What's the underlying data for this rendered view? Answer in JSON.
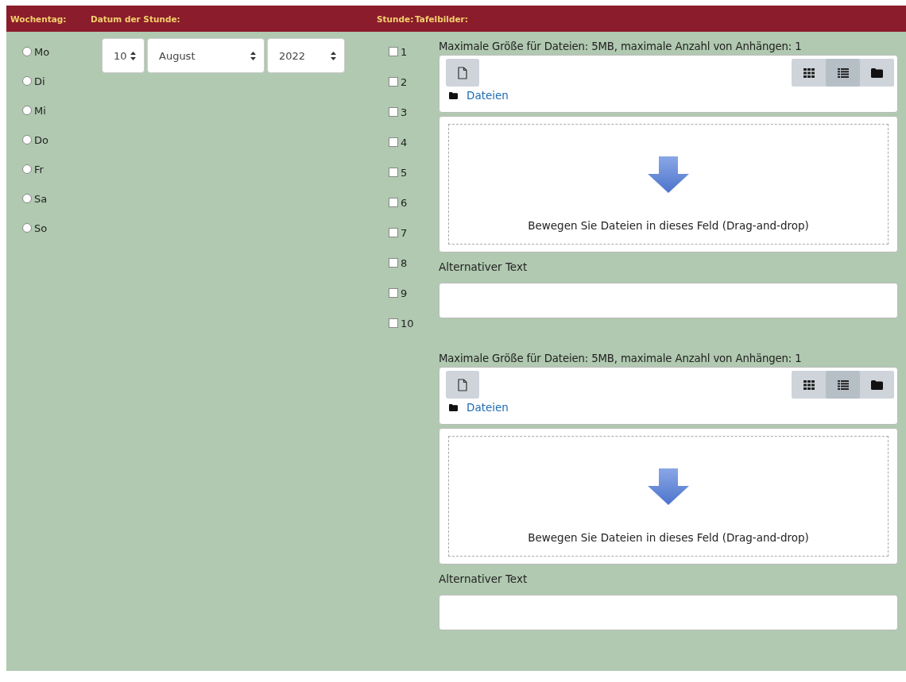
{
  "header": {
    "weekday": "Wochentag:",
    "date": "Datum der Stunde:",
    "hour": "Stunde:",
    "boards": "Tafelbilder:"
  },
  "weekdays": [
    {
      "label": "Mo",
      "selected": false
    },
    {
      "label": "Di",
      "selected": false
    },
    {
      "label": "Mi",
      "selected": false
    },
    {
      "label": "Do",
      "selected": false
    },
    {
      "label": "Fr",
      "selected": false
    },
    {
      "label": "Sa",
      "selected": false
    },
    {
      "label": "So",
      "selected": false
    }
  ],
  "date": {
    "day": "10",
    "month": "August",
    "year": "2022"
  },
  "hours": [
    {
      "label": "1",
      "checked": false
    },
    {
      "label": "2",
      "checked": false
    },
    {
      "label": "3",
      "checked": false
    },
    {
      "label": "4",
      "checked": false
    },
    {
      "label": "5",
      "checked": false
    },
    {
      "label": "6",
      "checked": false
    },
    {
      "label": "7",
      "checked": false
    },
    {
      "label": "8",
      "checked": false
    },
    {
      "label": "9",
      "checked": false
    },
    {
      "label": "10",
      "checked": false
    }
  ],
  "uploads": [
    {
      "limits": "Maximale Größe für Dateien: 5MB, maximale Anzahl von Anhängen: 1",
      "path": "Dateien",
      "drop_hint": "Bewegen Sie Dateien in dieses Feld (Drag-and-drop)",
      "alt_label": "Alternativer Text",
      "views": [
        {
          "kind": "grid",
          "selected": false
        },
        {
          "kind": "list",
          "selected": true
        },
        {
          "kind": "tree",
          "selected": false
        }
      ]
    },
    {
      "limits": "Maximale Größe für Dateien: 5MB, maximale Anzahl von Anhängen: 1",
      "path": "Dateien",
      "drop_hint": "Bewegen Sie Dateien in dieses Feld (Drag-and-drop)",
      "alt_label": "Alternativer Text",
      "views": [
        {
          "kind": "grid",
          "selected": false
        },
        {
          "kind": "list",
          "selected": true
        },
        {
          "kind": "tree",
          "selected": false
        }
      ]
    }
  ]
}
